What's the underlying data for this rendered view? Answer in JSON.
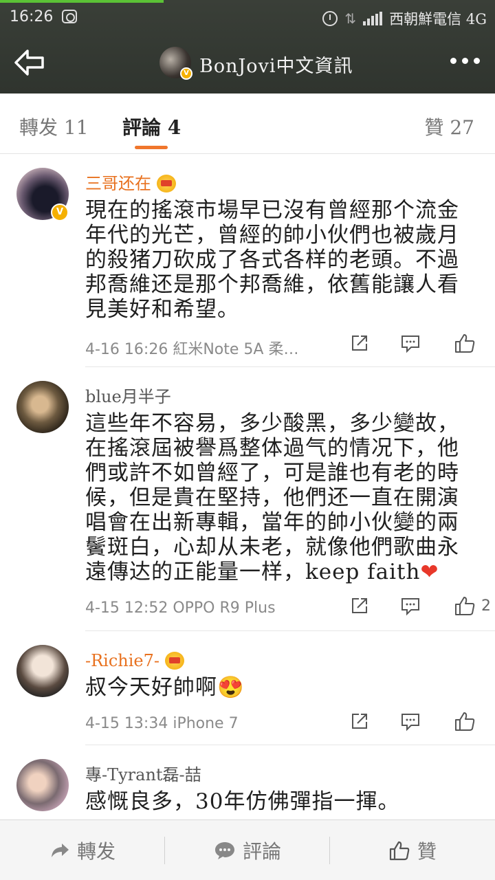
{
  "status_bar": {
    "time": "16:26",
    "carrier": "西朝鮮電信 4G",
    "icons": [
      "screenshot-icon",
      "alarm-icon",
      "data-arrows-icon",
      "signal-icon"
    ]
  },
  "nav": {
    "title": "BonJovi中文資訊",
    "back_icon": "back-arrow-icon",
    "more_icon": "more-icon",
    "verified_badge": "V"
  },
  "tabs": {
    "repost": "轉发 11",
    "comments": "評論 4",
    "likes": "贊 27",
    "accent_color": "#f0762c"
  },
  "comments": [
    {
      "user": "三哥还在",
      "vip": true,
      "verified": true,
      "text": "現在的搖滾市場早已沒有曾經那个流金年代的光芒，曾經的帥小伙們也被歲月的殺猪刀砍成了各式各样的老頭。不過邦喬維还是那个邦喬維，依舊能讓人看見美好和希望。",
      "time": "4-16 16:26",
      "device": "紅米Note 5A 柔…",
      "likes": ""
    },
    {
      "user": "blue月半子",
      "vip": false,
      "verified": false,
      "text": "這些年不容易，多少酸黑，多少變故，在搖滾屆被譽爲整体過气的情况下，他們或許不如曾經了，可是誰也有老的時候，但是貴在堅持，他們还一直在開演唱會在出新專輯，當年的帥小伙變的兩鬢斑白，心却从未老，就像他們歌曲永遠傳达的正能量一样，keep faith",
      "emoji": "❤",
      "time": "4-15 12:52",
      "device": "OPPO R9 Plus",
      "likes": "2"
    },
    {
      "user": "-Richie7-",
      "vip": true,
      "verified": false,
      "text": "叔今天好帥啊",
      "emoji": "😍",
      "time": "4-15 13:34",
      "device": "iPhone 7",
      "likes": ""
    },
    {
      "user": "專-Tyrant磊-喆",
      "vip": false,
      "verified": false,
      "text": "感慨良多，30年仿佛彈指一揮。"
    }
  ],
  "bottom_bar": {
    "repost": "轉发",
    "comment": "評論",
    "like": "贊"
  }
}
